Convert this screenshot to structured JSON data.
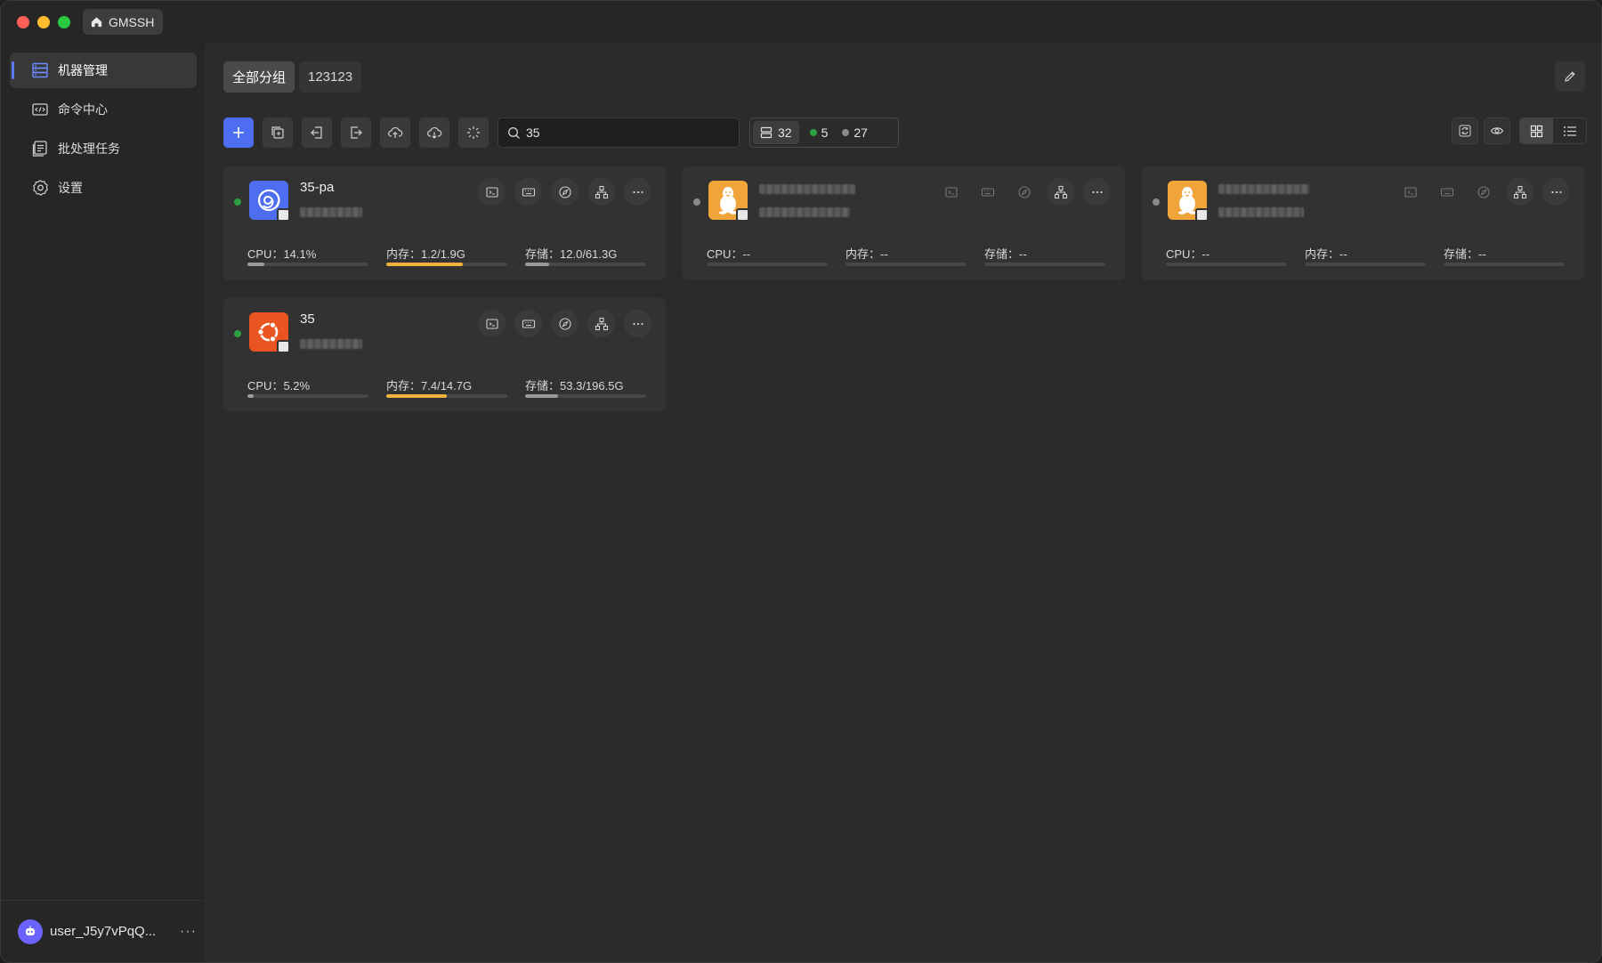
{
  "app": {
    "tab_label": "GMSSH"
  },
  "sidebar": {
    "items": [
      {
        "label": "机器管理",
        "icon": "server-icon",
        "active": true
      },
      {
        "label": "命令中心",
        "icon": "code-icon",
        "active": false
      },
      {
        "label": "批处理任务",
        "icon": "tasks-icon",
        "active": false
      },
      {
        "label": "设置",
        "icon": "gear-icon",
        "active": false
      }
    ],
    "user": {
      "name": "user_J5y7vPqQ...",
      "more": "···"
    }
  },
  "groups": {
    "tabs": [
      "全部分组",
      "123123"
    ]
  },
  "toolbar": {
    "search_value": "35",
    "stats": {
      "total": "32",
      "online": "5",
      "offline": "27"
    }
  },
  "colors": {
    "accent": "#4e6ef2",
    "online": "#2ea043",
    "offline": "#8a8a8a",
    "memory": "#f0b43c",
    "bar_default": "#9a9a9a"
  },
  "servers": [
    {
      "name": "35-pa",
      "os": "debian",
      "status": "online",
      "cpu": {
        "label": "CPU：",
        "value": "14.1%",
        "fraction": 0.141
      },
      "mem": {
        "label": "内存：",
        "value": "1.2/1.9G",
        "fraction": 0.63
      },
      "disk": {
        "label": "存储：",
        "value": "12.0/61.3G",
        "fraction": 0.196
      }
    },
    {
      "name": "",
      "os": "linux",
      "status": "offline",
      "cpu": {
        "label": "CPU：",
        "value": "--",
        "fraction": 0
      },
      "mem": {
        "label": "内存：",
        "value": "--",
        "fraction": 0
      },
      "disk": {
        "label": "存储：",
        "value": "--",
        "fraction": 0
      }
    },
    {
      "name": "",
      "os": "linux",
      "status": "offline",
      "cpu": {
        "label": "CPU：",
        "value": "--",
        "fraction": 0
      },
      "mem": {
        "label": "内存：",
        "value": "--",
        "fraction": 0
      },
      "disk": {
        "label": "存储：",
        "value": "--",
        "fraction": 0
      }
    },
    {
      "name": "35",
      "os": "ubuntu",
      "status": "online",
      "cpu": {
        "label": "CPU：",
        "value": "5.2%",
        "fraction": 0.052
      },
      "mem": {
        "label": "内存：",
        "value": "7.4/14.7G",
        "fraction": 0.503
      },
      "disk": {
        "label": "存储：",
        "value": "53.3/196.5G",
        "fraction": 0.271
      }
    }
  ]
}
